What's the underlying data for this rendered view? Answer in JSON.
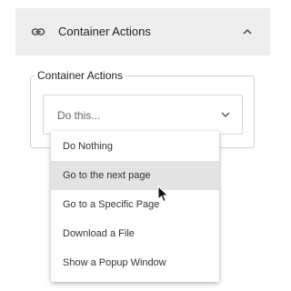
{
  "panel": {
    "title": "Container Actions",
    "icon": "link-icon",
    "expand_icon": "chevron-up-icon"
  },
  "field": {
    "legend": "Container Actions",
    "placeholder": "Do this...",
    "dropdown_icon": "chevron-down-icon"
  },
  "dropdown": {
    "options": [
      "Do Nothing",
      "Go to the next page",
      "Go to a Specific Page",
      "Download a File",
      "Show a Popup Window"
    ],
    "highlighted": "Go to the next page"
  },
  "colors": {
    "header_bg": "#eeeeee",
    "highlight_bg": "#e3e3e3"
  }
}
